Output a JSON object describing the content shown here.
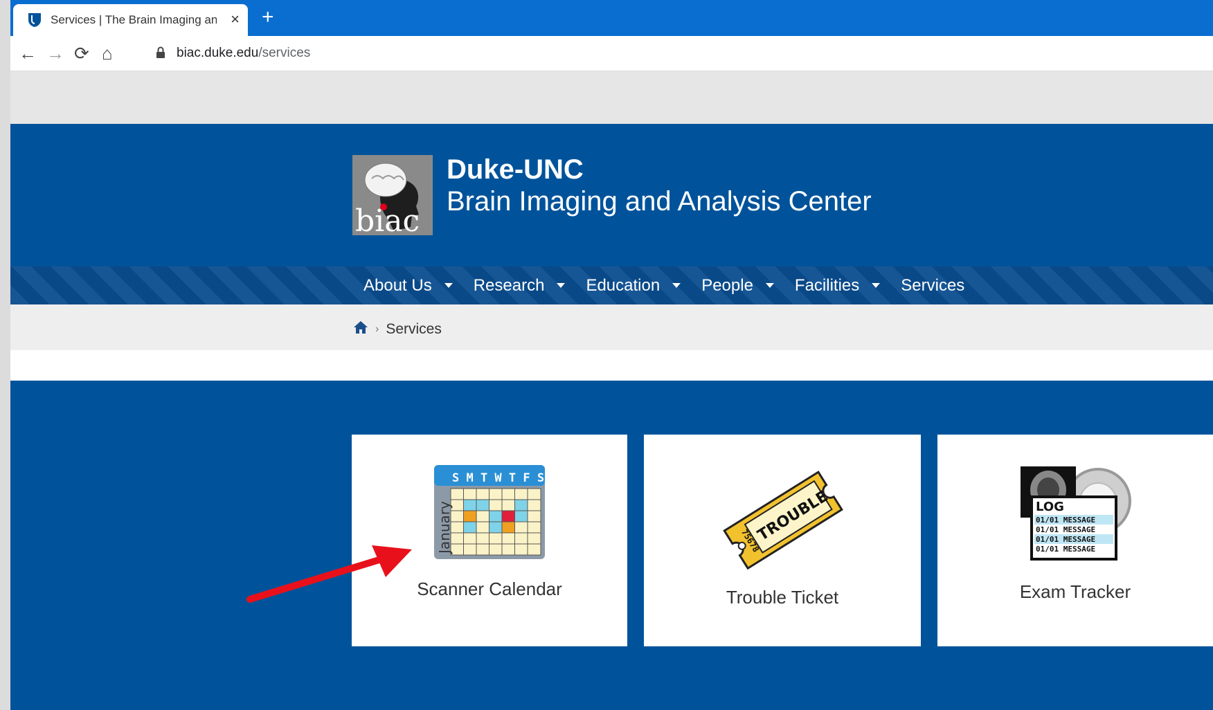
{
  "browser": {
    "tab_title": "Services | The Brain Imaging and",
    "close_glyph": "×",
    "new_tab_glyph": "+",
    "url_host": "biac.duke.edu",
    "url_path": "/services",
    "back_glyph": "←",
    "forward_glyph": "→",
    "reload_glyph": "⟳",
    "home_glyph": "⌂"
  },
  "site": {
    "name_line1": "Duke-UNC",
    "name_line2": "Brain Imaging and Analysis Center",
    "logo_text": "biac"
  },
  "nav": {
    "items": [
      {
        "label": "About Us",
        "dropdown": true
      },
      {
        "label": "Research",
        "dropdown": true
      },
      {
        "label": "Education",
        "dropdown": true
      },
      {
        "label": "People",
        "dropdown": true
      },
      {
        "label": "Facilities",
        "dropdown": true
      },
      {
        "label": "Services",
        "dropdown": false
      }
    ]
  },
  "breadcrumb": {
    "separator": "›",
    "current": "Services"
  },
  "services": {
    "cards": [
      {
        "label": "Scanner Calendar",
        "icon": "calendar-icon",
        "calendar_days": "S M T W T F S",
        "calendar_month": "January"
      },
      {
        "label": "Trouble Ticket",
        "icon": "ticket-icon",
        "ticket_text": "TROUBLE",
        "ticket_number": "75678"
      },
      {
        "label": "Exam Tracker",
        "icon": "log-icon",
        "log_title": "LOG",
        "log_line": "01/01 MESSAGE"
      }
    ]
  },
  "colors": {
    "tabbar": "#0a6ed1",
    "header": "#00539b",
    "annotation_arrow": "#e8111b"
  }
}
